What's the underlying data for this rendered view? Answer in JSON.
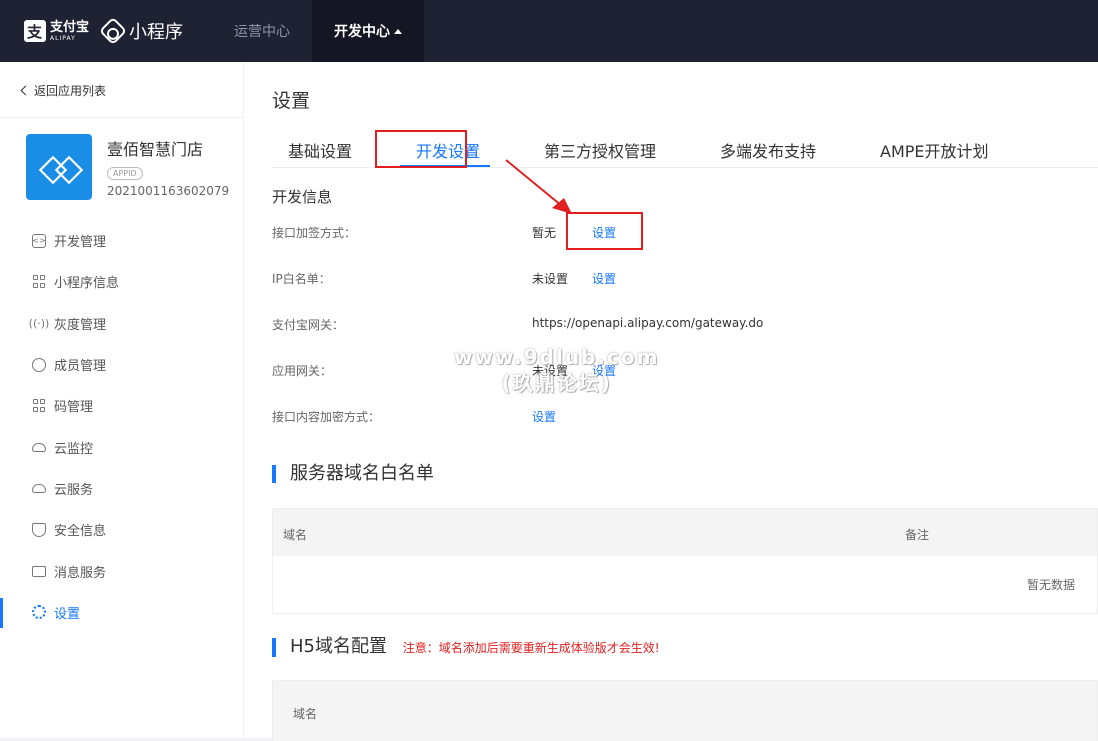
{
  "topbar": {
    "brand_cn": "支付宝",
    "brand_en": "ALIPAY",
    "product": "小程序",
    "nav": [
      {
        "label": "运营中心",
        "active": false
      },
      {
        "label": "开发中心",
        "active": true
      }
    ]
  },
  "sidebar": {
    "back_label": "返回应用列表",
    "app_name": "壹佰智慧门店",
    "appid_badge": "APPID",
    "app_id": "2021001163602079",
    "menu": [
      {
        "label": "开发管理",
        "icon": "code-icon"
      },
      {
        "label": "小程序信息",
        "icon": "grid-icon"
      },
      {
        "label": "灰度管理",
        "icon": "broadcast-icon"
      },
      {
        "label": "成员管理",
        "icon": "user-icon"
      },
      {
        "label": "码管理",
        "icon": "qrcode-icon"
      },
      {
        "label": "云监控",
        "icon": "cloud-icon"
      },
      {
        "label": "云服务",
        "icon": "cloud-icon"
      },
      {
        "label": "安全信息",
        "icon": "shield-icon"
      },
      {
        "label": "消息服务",
        "icon": "monitor-icon"
      },
      {
        "label": "设置",
        "icon": "gear-icon",
        "active": true
      }
    ]
  },
  "main": {
    "title": "设置",
    "tabs": [
      "基础设置",
      "开发设置",
      "第三方授权管理",
      "多端发布支持",
      "AMPE开放计划"
    ],
    "active_tab": "开发设置",
    "dev_info": {
      "heading": "开发信息",
      "rows": [
        {
          "label": "接口加签方式：",
          "value": "暂无",
          "link": "设置"
        },
        {
          "label": "IP白名单：",
          "value": "未设置",
          "link": "设置"
        },
        {
          "label": "支付宝网关：",
          "value": "https://openapi.alipay.com/gateway.do",
          "link": ""
        },
        {
          "label": "应用网关：",
          "value": "未设置",
          "link": "设置"
        },
        {
          "label": "接口内容加密方式：",
          "value": "",
          "link": "设置"
        }
      ]
    },
    "watermark": {
      "line1": "www.9dlub.com",
      "line2": "(玖鼎论坛)"
    },
    "server_whitelist": {
      "heading": "服务器域名白名单",
      "columns": [
        "域名",
        "备注"
      ],
      "empty_text": "暂无数据"
    },
    "h5_config": {
      "heading": "H5域名配置",
      "notice": "注意：域名添加后需要重新生成体验版才会生效!",
      "columns": [
        "域名"
      ]
    },
    "colors": {
      "accent": "#1677ff",
      "highlight": "#e02020"
    }
  }
}
